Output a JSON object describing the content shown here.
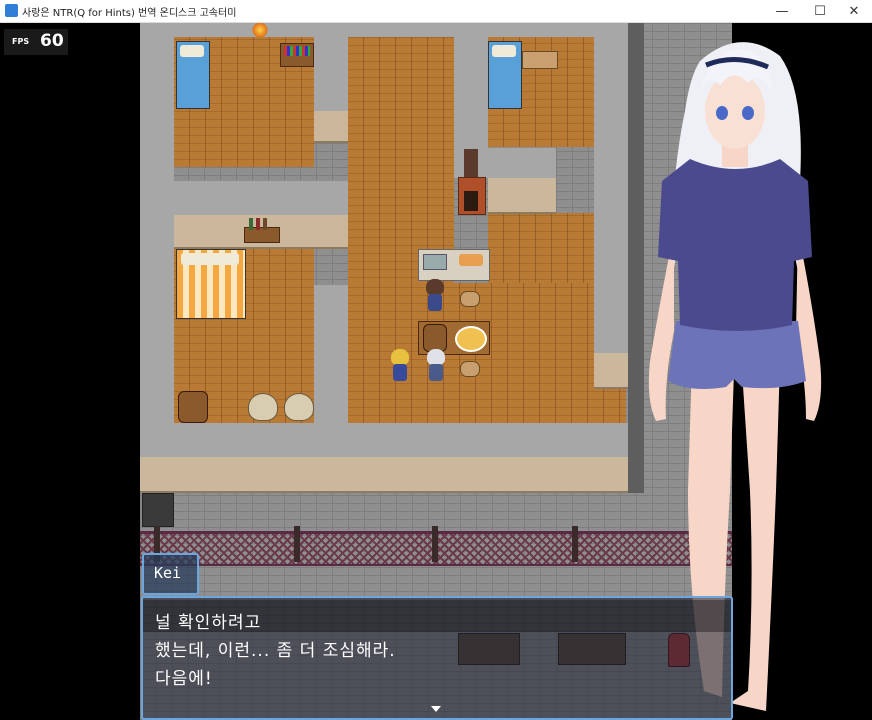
{
  "window": {
    "title": "사랑은 NTR(Q for Hints) 번역 온디스크 고속터미",
    "minimize_label": "—",
    "maximize_label": "☐",
    "close_label": "✕"
  },
  "fps": {
    "label": "FPS",
    "value": "60"
  },
  "dialogue": {
    "speaker": "Kei",
    "lines": [
      "널 확인하려고",
      "했는데, 이런... 좀 더 조심해라.",
      "다음에!"
    ]
  },
  "colors": {
    "floor": "#b87a35",
    "wall": "#a7a7a7",
    "window_border": "#6aa6e0",
    "shirt": "#4c4a8e",
    "shorts": "#6d73b8"
  }
}
